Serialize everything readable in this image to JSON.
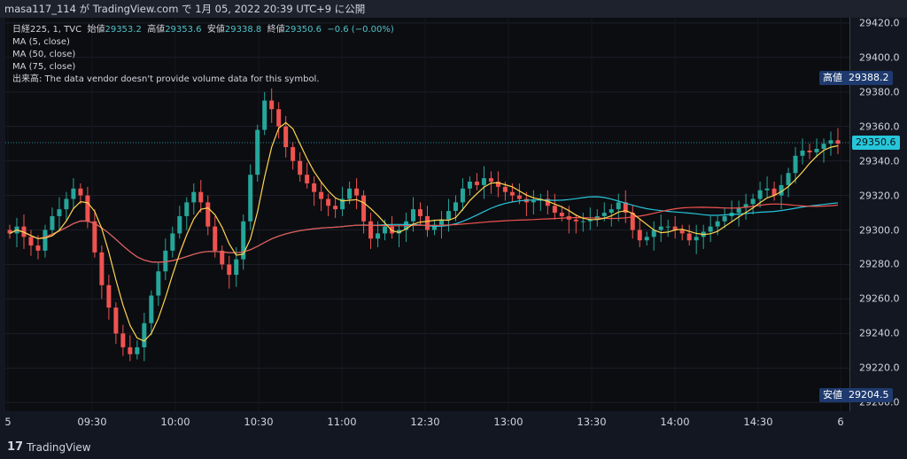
{
  "header": {
    "title": "masa117_114 が TradingView.com で 1月 05, 2022 20:39 UTC+9 に公開"
  },
  "legend": {
    "symbol": "日経225, 1, TVC",
    "open_label": "始値",
    "open": "29353.2",
    "high_label": "高値",
    "high": "29353.6",
    "low_label": "安値",
    "low": "29338.8",
    "close_label": "終値",
    "close": "29350.6",
    "change": "−0.6 (−0.00%)",
    "ma5": "MA (5, close)",
    "ma50": "MA (50, close)",
    "ma75": "MA (75, close)",
    "volume": "出来高: The data vendor doesn't provide volume data for this symbol."
  },
  "badges": {
    "high_label": "高値",
    "high_value": "29388.2",
    "low_label": "安値",
    "low_value": "29204.5",
    "last_value": "29350.6"
  },
  "colors": {
    "up": "#26a69a",
    "down": "#ef5350",
    "ma5": "#ffd54f",
    "ma50": "#26c6da",
    "ma75": "#ef5350",
    "badge": "#1e3a6e",
    "last": "#26c6da"
  },
  "footer": {
    "brand": "TradingView"
  },
  "chart_data": {
    "type": "candlestick",
    "title": "日経225, 1, TVC",
    "y_range": [
      29195,
      29423
    ],
    "yticks": [
      "29420.0",
      "29400.0",
      "29380.0",
      "29360.0",
      "29340.0",
      "29320.0",
      "29300.0",
      "29280.0",
      "29260.0",
      "29240.0",
      "29220.0",
      "29200.0"
    ],
    "xticks": [
      "5",
      "09:30",
      "10:00",
      "10:30",
      "11:00",
      "12:30",
      "13:00",
      "13:30",
      "14:00",
      "14:30",
      "6"
    ],
    "series": [
      {
        "name": "price (close)",
        "values": [
          29298,
          29302,
          29296,
          29291,
          29288,
          29300,
          29308,
          29312,
          29318,
          29324,
          29320,
          29305,
          29287,
          29268,
          29255,
          29240,
          29232,
          29228,
          29232,
          29246,
          29262,
          29276,
          29288,
          29298,
          29308,
          29316,
          29322,
          29316,
          29302,
          29288,
          29280,
          29274,
          29283,
          29305,
          29332,
          29358,
          29375,
          29370,
          29360,
          29348,
          29340,
          29332,
          29327,
          29322,
          29318,
          29314,
          29312,
          29318,
          29324,
          29320,
          29305,
          29295,
          29298,
          29302,
          29298,
          29300,
          29305,
          29312,
          29308,
          29300,
          29303,
          29306,
          29311,
          29316,
          29324,
          29328,
          29326,
          29330,
          29328,
          29325,
          29322,
          29320,
          29318,
          29316,
          29317,
          29318,
          29314,
          29310,
          29308,
          29306,
          29305,
          29305,
          29306,
          29308,
          29310,
          29312,
          29316,
          29310,
          29300,
          29294,
          29296,
          29300,
          29302,
          29302,
          29300,
          29298,
          29294,
          29296,
          29299,
          29302,
          29305,
          29308,
          29310,
          29313,
          29315,
          29318,
          29323,
          29324,
          29320,
          29326,
          29333,
          29343,
          29346,
          29345,
          29347,
          29350,
          29352,
          29350
        ]
      }
    ]
  }
}
